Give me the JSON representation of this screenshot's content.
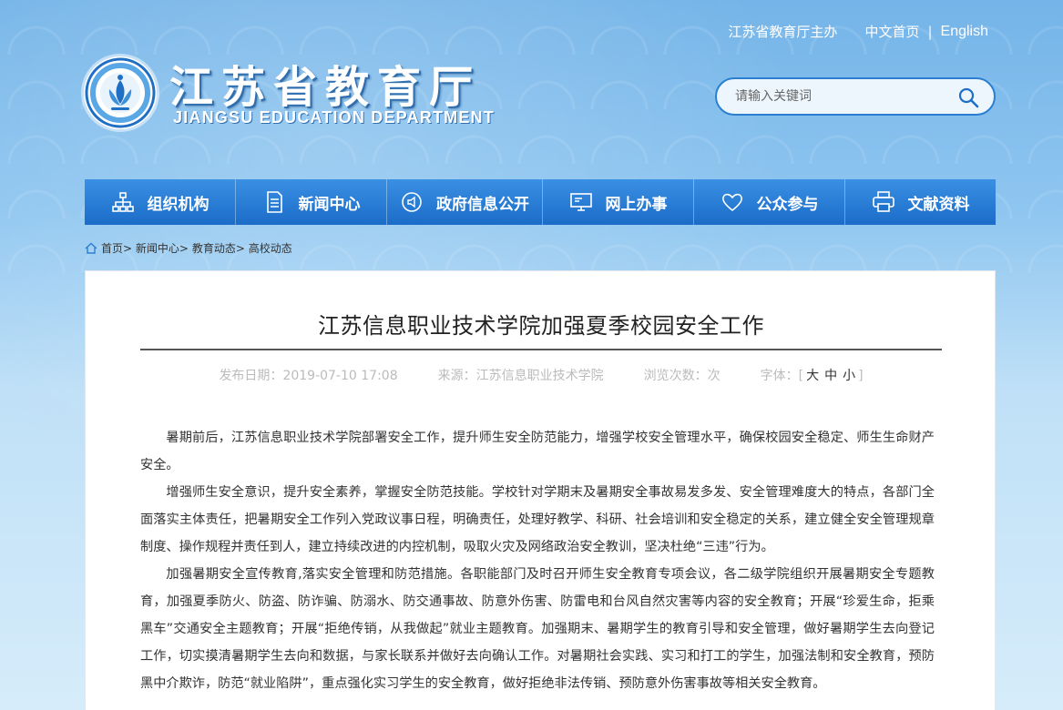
{
  "header": {
    "host_text": "江苏省教育厅主办",
    "link_cn": "中文首页",
    "separator": "|",
    "link_en": "English",
    "logo_title": "江苏省教育厅",
    "logo_subtitle": "JIANGSU EDUCATION DEPARTMENT",
    "search_placeholder": "请输入关键词"
  },
  "nav": {
    "items": [
      {
        "label": "组织机构",
        "icon": "org-chart-icon"
      },
      {
        "label": "新闻中心",
        "icon": "document-icon"
      },
      {
        "label": "政府信息公开",
        "icon": "speaker-icon"
      },
      {
        "label": "网上办事",
        "icon": "monitor-icon"
      },
      {
        "label": "公众参与",
        "icon": "heart-icon"
      },
      {
        "label": "文献资料",
        "icon": "printer-icon"
      }
    ]
  },
  "breadcrumb": {
    "home": "首页",
    "news": "新闻中心",
    "edu": "教育动态",
    "current": "高校动态",
    "sep": ">"
  },
  "article": {
    "title": "江苏信息职业技术学院加强夏季校园安全工作",
    "publish_label": "发布日期：",
    "publish_date": "2019-07-10 17:08",
    "source_label": "来源：",
    "source": "江苏信息职业技术学院",
    "views_label": "浏览次数：",
    "views_unit": "次",
    "font_label": "字体：",
    "font_large": "大",
    "font_medium": "中",
    "font_small": "小",
    "paragraphs": [
      "暑期前后，江苏信息职业技术学院部署安全工作，提升师生安全防范能力，增强学校安全管理水平，确保校园安全稳定、师生生命财产安全。",
      "增强师生安全意识，提升安全素养，掌握安全防范技能。学校针对学期末及暑期安全事故易发多发、安全管理难度大的特点，各部门全面落实主体责任，把暑期安全工作列入党政议事日程，明确责任，处理好教学、科研、社会培训和安全稳定的关系，建立健全安全管理规章制度、操作规程并责任到人，建立持续改进的内控机制，吸取火灾及网络政治安全教训，坚决杜绝“三违”行为。",
      "加强暑期安全宣传教育,落实安全管理和防范措施。各职能部门及时召开师生安全教育专项会议，各二级学院组织开展暑期安全专题教育，加强夏季防火、防盗、防诈骗、防溺水、防交通事故、防意外伤害、防雷电和台风自然灾害等内容的安全教育；开展“珍爱生命，拒乘黑车”交通安全主题教育；开展“拒绝传销，从我做起”就业主题教育。加强期末、暑期学生的教育引导和安全管理，做好暑期学生去向登记工作，切实摸清暑期学生去向和数据，与家长联系并做好去向确认工作。对暑期社会实践、实习和打工的学生，加强法制和安全教育，预防黑中介欺诈，防范“就业陷阱”，重点强化实习学生的安全教育，做好拒绝非法传销、预防意外伤害事故等相关安全教育。"
    ]
  },
  "colors": {
    "nav_top": "#3a90e3",
    "nav_bottom": "#1b6cc8",
    "search_border": "#2a7fd0"
  }
}
